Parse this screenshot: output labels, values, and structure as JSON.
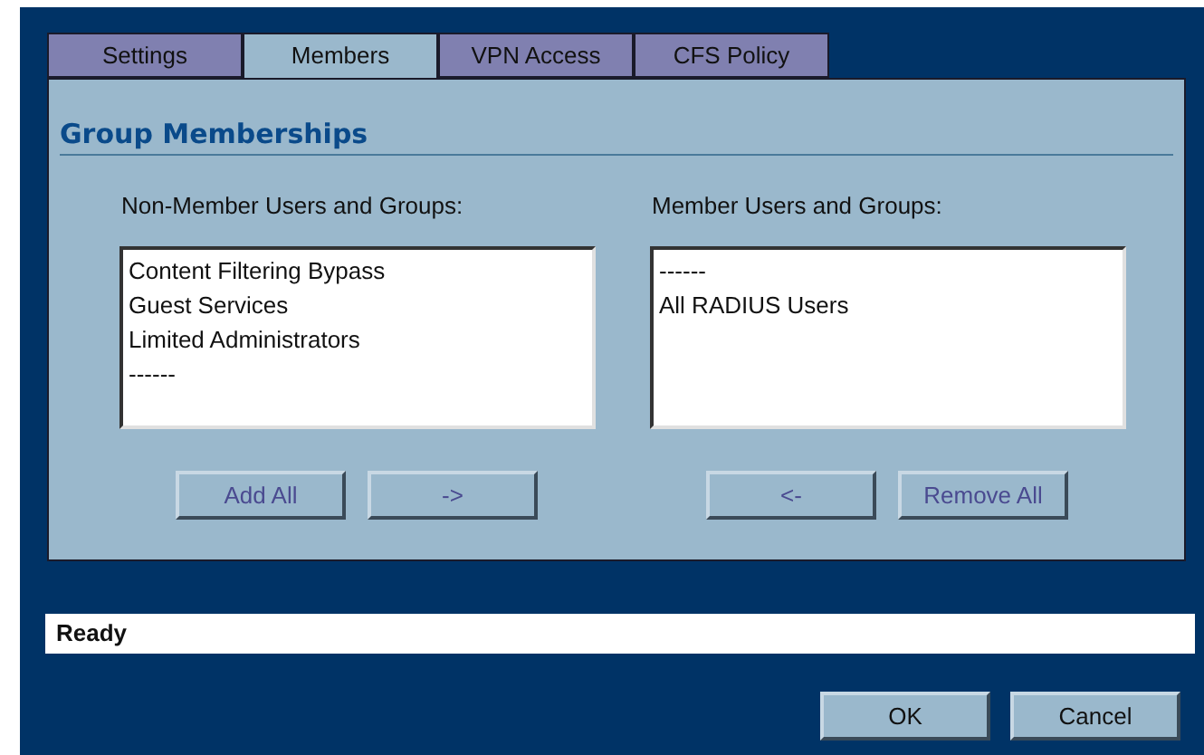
{
  "tabs": [
    {
      "label": "Settings",
      "selected": false
    },
    {
      "label": "Members",
      "selected": true
    },
    {
      "label": "VPN Access",
      "selected": false
    },
    {
      "label": "CFS Policy",
      "selected": false
    }
  ],
  "section_title": "Group Memberships",
  "lists": [
    {
      "label": "Non-Member Users and Groups:",
      "items": [
        "Content Filtering Bypass",
        "Guest Services",
        "Limited Administrators",
        "------"
      ],
      "buttons": [
        {
          "label": "Add All",
          "disabled": true
        },
        {
          "label": "->",
          "disabled": true
        }
      ]
    },
    {
      "label": "Member Users and Groups:",
      "items": [
        "------",
        "All RADIUS Users"
      ],
      "buttons": [
        {
          "label": "<-",
          "disabled": true
        },
        {
          "label": "Remove All",
          "disabled": true
        }
      ]
    }
  ],
  "status_bar": "Ready",
  "dialog_buttons": [
    {
      "label": "OK",
      "disabled": false
    },
    {
      "label": "Cancel",
      "disabled": false
    }
  ]
}
